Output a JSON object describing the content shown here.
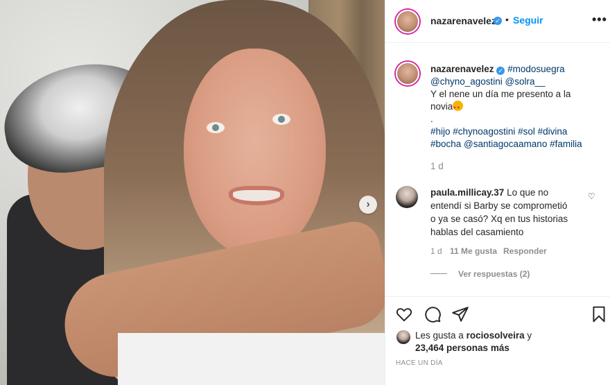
{
  "post": {
    "username": "nazarenavelez",
    "follow_label": "Seguir",
    "separator": "•",
    "more_label": "•••"
  },
  "caption": {
    "username": "nazarenavelez",
    "line1_tag": "#modosuegra",
    "line2": "@chyno_agostini @solra__",
    "line3": "Y el nene un día me presento a la",
    "line4": "novia",
    "line5": ".",
    "line6": "#hijo #chynoagostini #sol #divina",
    "line7": "#bocha @santiagocaamano #familia",
    "time": "1 d"
  },
  "comment": {
    "username": "paula.millicay.37",
    "line1_text": "Lo que no",
    "line2": "entendí si Barby se comprometió",
    "line3": "o ya se casó? Xq en tus historias",
    "line4": "hablas del casamiento",
    "time": "1 d",
    "likes": "11 Me gusta",
    "reply_label": "Responder",
    "view_replies": "Ver respuestas (2)"
  },
  "likes": {
    "prefix": "Les gusta a",
    "user": "rociosolveira",
    "suffix": "y",
    "count_line": "23,464 personas más"
  },
  "timestamp": "HACE UN DÍA",
  "icons": {
    "verified": "verified-badge-icon",
    "heart": "heart-icon",
    "comment": "comment-icon",
    "share": "share-icon",
    "save": "bookmark-icon",
    "next": "chevron-right-icon"
  },
  "colors": {
    "accent": "#0095f6",
    "verified": "#3897f0",
    "muted": "#8e8e8e",
    "link": "#00376b"
  }
}
